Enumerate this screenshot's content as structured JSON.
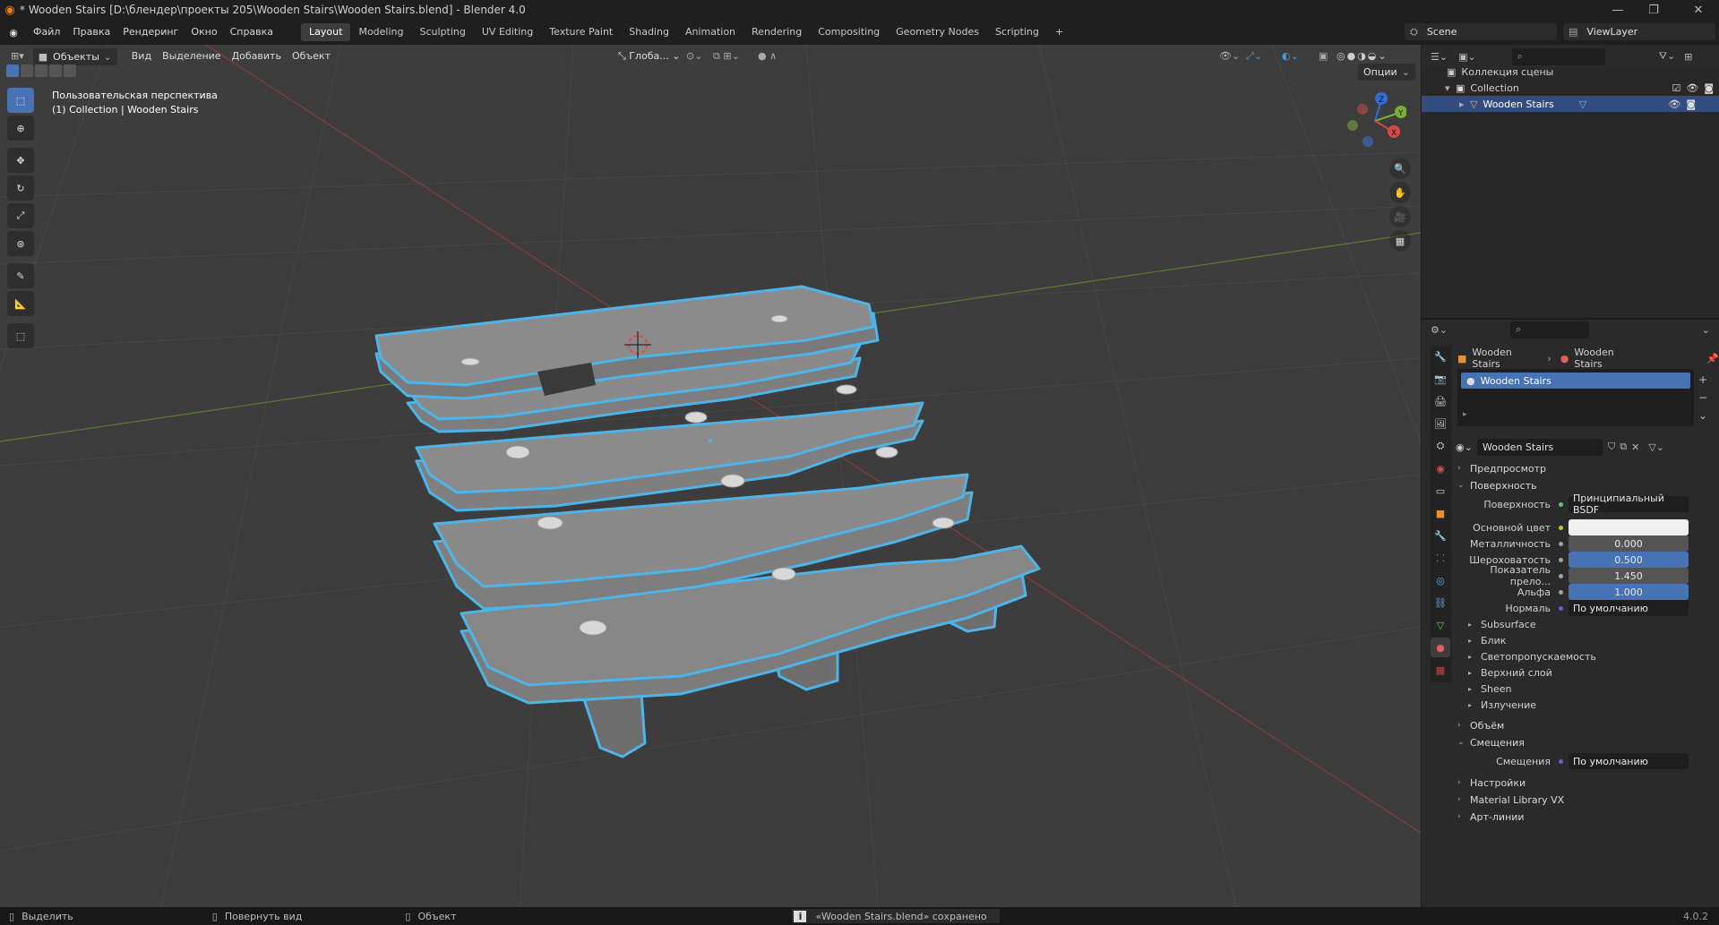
{
  "window": {
    "title": "* Wooden Stairs [D:\\блендер\\проекты 205\\Wooden Stairs\\Wooden Stairs.blend] - Blender 4.0"
  },
  "menu": [
    "Файл",
    "Правка",
    "Рендеринг",
    "Окно",
    "Справка"
  ],
  "workspaces": [
    "Layout",
    "Modeling",
    "Sculpting",
    "UV Editing",
    "Texture Paint",
    "Shading",
    "Animation",
    "Rendering",
    "Compositing",
    "Geometry Nodes",
    "Scripting"
  ],
  "active_workspace": "Layout",
  "scene": {
    "name": "Scene",
    "view_layer": "ViewLayer"
  },
  "viewport_header": {
    "mode": "Объекты",
    "menus": [
      "Вид",
      "Выделение",
      "Добавить",
      "Объект"
    ],
    "transform_orientation": "Глоба...",
    "options": "Опции"
  },
  "viewport": {
    "overlay_line1": "Пользовательская перспектива",
    "overlay_line2": "(1) Collection | Wooden Stairs",
    "axis_labels": {
      "z": "Z",
      "y": "Y",
      "x": "X"
    },
    "colors": {
      "grid_bg": "#3d3d3d",
      "x_axis": "#8a3c3c",
      "y_axis": "#5a7a2e",
      "selection_outline": "#4db4e8"
    }
  },
  "outliner": {
    "root": "Коллекция сцены",
    "collection": "Collection",
    "object": "Wooden Stairs"
  },
  "properties": {
    "breadcrumb_object": "Wooden Stairs",
    "breadcrumb_material": "Wooden Stairs",
    "slot_name": "Wooden Stairs",
    "material_name": "Wooden Stairs",
    "sections": {
      "preview": "Предпросмотр",
      "surface": "Поверхность",
      "volume": "Объём",
      "displacement": "Смещения",
      "settings": "Настройки",
      "material_library": "Material Library VX",
      "line_art": "Арт-линии"
    },
    "surface_field_label": "Поверхность",
    "surface_field_value": "Принципиальный BSDF",
    "params": [
      {
        "label": "Основной цвет",
        "value": "",
        "style": "white"
      },
      {
        "label": "Металличность",
        "value": "0.000",
        "style": "gray"
      },
      {
        "label": "Шероховатость",
        "value": "0.500",
        "style": "blue"
      },
      {
        "label": "Показатель прело...",
        "value": "1.450",
        "style": "gray"
      },
      {
        "label": "Альфа",
        "value": "1.000",
        "style": "blue"
      },
      {
        "label": "Нормаль",
        "value": "По умолчанию",
        "style": "dark"
      }
    ],
    "subpanels": [
      "Subsurface",
      "Блик",
      "Светопропускаемость",
      "Верхний слой",
      "Sheen",
      "Излучение"
    ],
    "displacement_label": "Смещения",
    "displacement_value": "По умолчанию"
  },
  "statusbar": {
    "select": "Выделить",
    "rotate": "Повернуть вид",
    "object": "Объект",
    "message": "«Wooden Stairs.blend» сохранено",
    "version": "4.0.2"
  }
}
